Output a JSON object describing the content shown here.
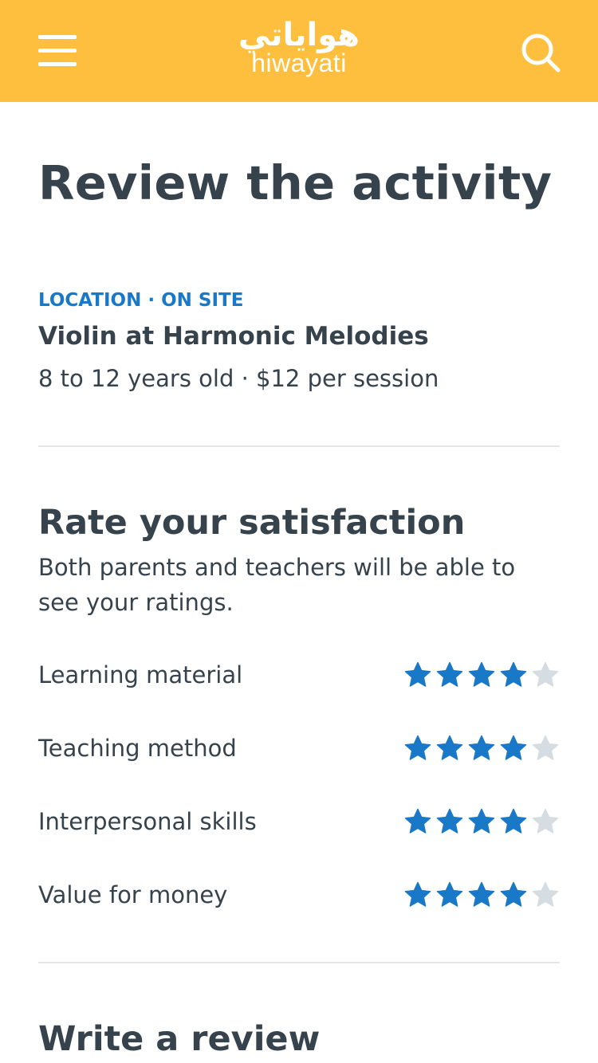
{
  "app": {
    "logo_arabic": "هواياتي",
    "logo_latin": "hiwayati",
    "brand_color": "#fdbf3d"
  },
  "header": {
    "menu_icon": "hamburger-menu-icon",
    "search_icon": "search-icon"
  },
  "page": {
    "title": "Review the activity"
  },
  "activity": {
    "location_label": "LOCATION · ON SITE",
    "name": "Violin at Harmonic Melodies",
    "meta": "8 to 12 years old · $12 per session"
  },
  "rating_section": {
    "title": "Rate your satisfaction",
    "description": "Both parents and teachers will be able to see your ratings.",
    "max_stars": 5,
    "filled_color": "#1a78c9",
    "empty_color": "#d6dde2",
    "items": [
      {
        "label": "Learning material",
        "rating": 4
      },
      {
        "label": "Teaching method",
        "rating": 4
      },
      {
        "label": "Interpersonal skills",
        "rating": 4
      },
      {
        "label": "Value for money",
        "rating": 4
      }
    ]
  },
  "review_section": {
    "title": "Write a review"
  }
}
